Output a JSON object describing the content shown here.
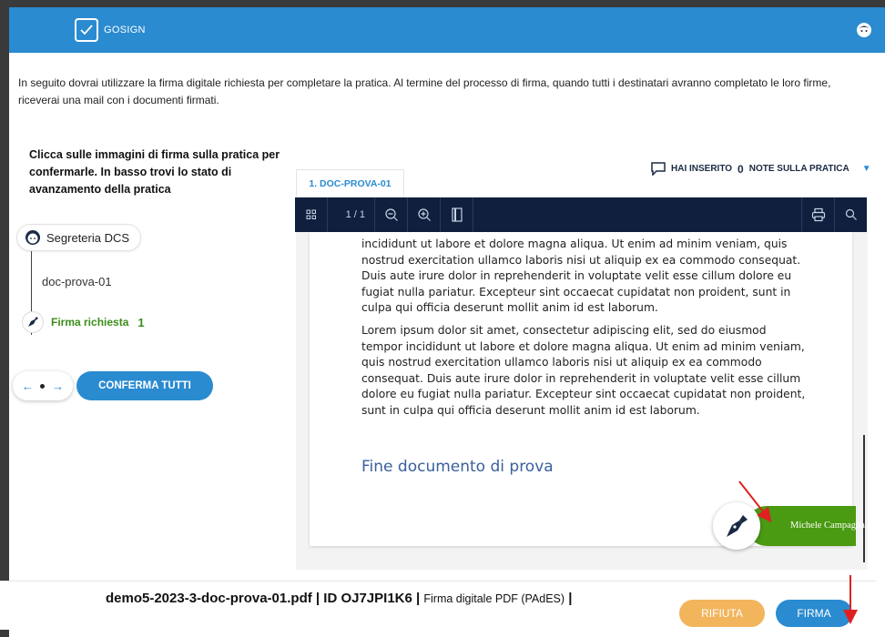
{
  "header": {
    "brand": "GOSIGN",
    "colors": {
      "bar": "#2a8bd0"
    }
  },
  "intro_text": "In seguito dovrai utilizzare la firma digitale richiesta per completare la pratica. Al termine del processo di firma, quando tutti i destinatari avranno completato le loro firme, riceverai una mail con i documenti firmati.",
  "instructions": "Clicca sulle immagini di firma sulla pratica per confermarle. In basso trovi lo stato di avanzamento della pratica",
  "notes": {
    "prefix": "HAI INSERITO",
    "count": "0",
    "suffix": "NOTE SULLA PRATICA"
  },
  "timeline": {
    "sender": "Segreteria DCS",
    "document": "doc-prova-01",
    "sign_label": "Firma richiesta",
    "sign_count": "1"
  },
  "actions": {
    "nav_prev": "←",
    "nav_next": "→",
    "confirm_all": "CONFERMA TUTTI"
  },
  "viewer": {
    "tab_label": "1. DOC-PROVA-01",
    "page_indicator": "1 / 1",
    "paragraph_1": "incididunt ut labore et dolore magna aliqua. Ut enim ad minim veniam, quis nostrud exercitation ullamco laboris nisi ut aliquip ex ea commodo consequat. Duis aute irure dolor in reprehenderit in voluptate velit esse cillum dolore eu fugiat nulla pariatur. Excepteur sint occaecat cupidatat non proident, sunt in culpa qui officia deserunt mollit anim id est laborum.",
    "paragraph_2": "Lorem ipsum dolor sit amet, consectetur adipiscing elit, sed do eiusmod tempor incididunt ut labore et dolore magna aliqua. Ut enim ad minim veniam, quis nostrud exercitation ullamco laboris nisi ut aliquip ex ea commodo consequat. Duis aute irure dolor in reprehenderit in voluptate velit esse cillum dolore eu fugiat nulla pariatur. Excepteur sint occaecat cupidatat non proident, sunt in culpa qui officia deserunt mollit anim id est laborum.",
    "end_title": "Fine documento di prova",
    "signer_name": "Michele Campagna"
  },
  "footer": {
    "filename": "demo5-2023-3-doc-prova-01.pdf",
    "id_label": "ID OJ7JPI1K6",
    "signature_type": "Firma digitale PDF (PAdES)",
    "refuse_label": "RIFIUTA",
    "sign_label": "FIRMA"
  },
  "icons": [
    "logo-check-icon",
    "user-avatar-icon",
    "comment-icon",
    "caret-down-icon",
    "thumbnails-icon",
    "zoom-out-icon",
    "zoom-in-icon",
    "page-fit-icon",
    "print-icon",
    "search-icon",
    "pen-nib-icon"
  ],
  "colors": {
    "accent": "#2a8bd0",
    "toolbar": "#0f1f3d",
    "sign_green": "#4a9a12",
    "refuse": "#f2b55c",
    "annotation_arrow": "#e02020"
  }
}
